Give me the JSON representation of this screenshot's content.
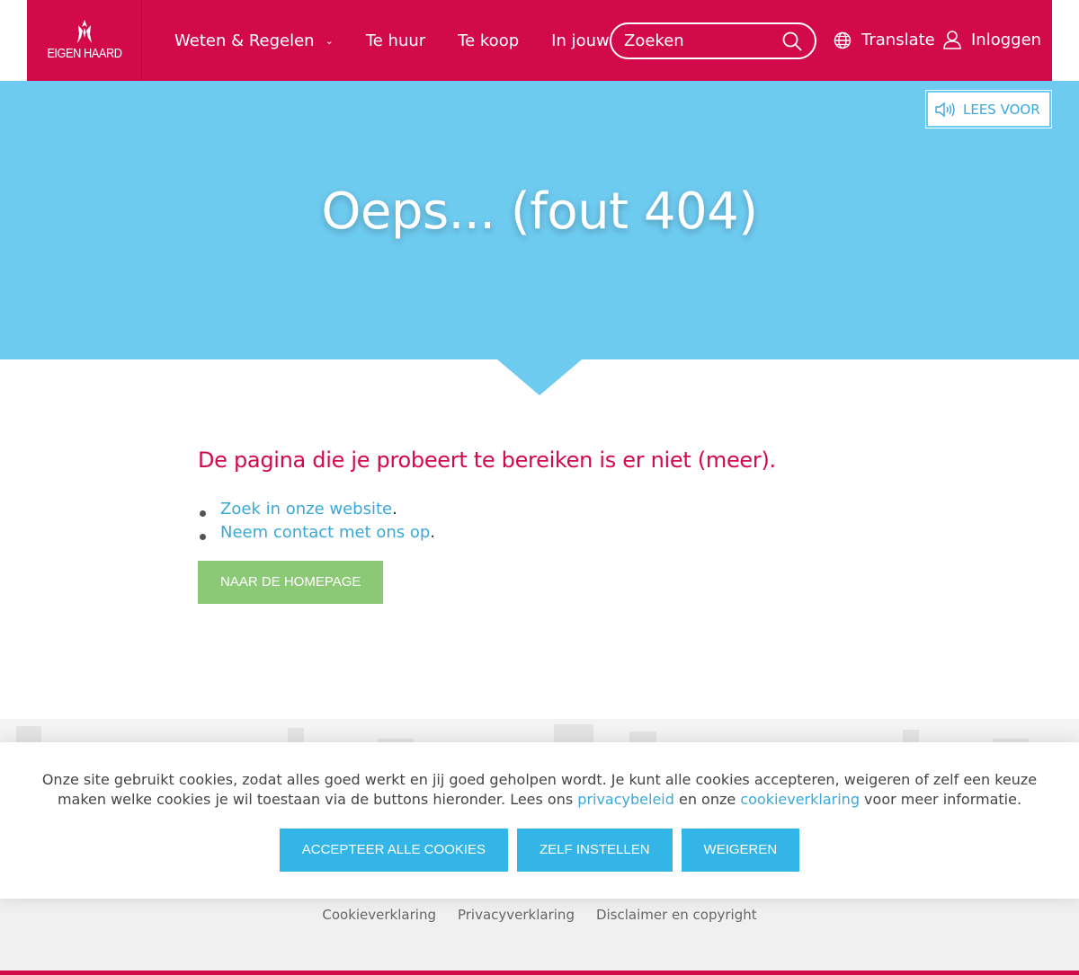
{
  "header": {
    "logo_text": "EIGEN HAARD",
    "nav": [
      {
        "label": "Weten & Regelen",
        "chevron": "⌄"
      },
      {
        "label": "Te huur"
      },
      {
        "label": "Te koop"
      },
      {
        "label": "In jouw wijk"
      }
    ],
    "search": {
      "placeholder": "Zoeken",
      "icon": "search-icon"
    },
    "translate_label": "Translate",
    "login_label": "Inloggen"
  },
  "hero": {
    "lees_voor_label": "LEES VOOR",
    "title": "Oeps... (fout 404)"
  },
  "content": {
    "heading": "De pagina die je probeert te bereiken is er niet (meer).",
    "links": [
      {
        "text": "Zoek in onze website",
        "suffix": "."
      },
      {
        "text": "Neem contact met ons op",
        "suffix": "."
      }
    ],
    "home_button": "NAAR DE HOMEPAGE"
  },
  "cookie": {
    "text_before": "Onze site gebruikt cookies, zodat alles goed werkt en jij goed geholpen wordt. Je kunt alle cookies accepteren, weigeren of zelf een keuze maken welke cookies je wil toestaan via de buttons hieronder. Lees ons ",
    "link_privacy": "privacybeleid",
    "text_middle": " en onze ",
    "link_cookie": "cookieverklaring",
    "text_after": " voor meer informatie.",
    "buttons": {
      "accept": "ACCEPTEER ALLE COOKIES",
      "settings": "ZELF INSTELLEN",
      "refuse": "WEIGEREN"
    }
  },
  "footer": {
    "links": [
      "Cookieverklaring",
      "Privacyverklaring",
      "Disclaimer en copyright"
    ]
  },
  "colors": {
    "brand": "#d20a4c",
    "hero": "#6ecbf0",
    "link": "#3aa8d8",
    "button_green": "#8cc976",
    "button_blue": "#33b5e8"
  }
}
